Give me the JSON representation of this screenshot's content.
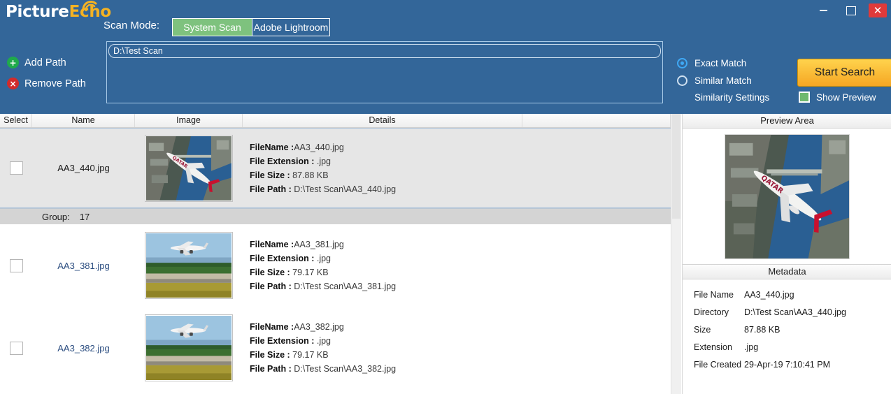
{
  "app": {
    "logo_primary": "Picture",
    "logo_accent": "Echo",
    "accent_color": "#f4b223",
    "header_color": "#336699"
  },
  "window_controls": {
    "minimize": "minimize-icon",
    "maximize": "maximize-icon",
    "close": "✕"
  },
  "scan": {
    "mode_label": "Scan Mode:",
    "tabs": [
      {
        "label": "System Scan",
        "active": true
      },
      {
        "label": "Adobe Lightroom",
        "active": false
      }
    ],
    "paths": [
      "D:\\Test Scan"
    ],
    "add_path": "Add Path",
    "add_icon": "+",
    "remove_path": "Remove Path",
    "remove_icon": "×"
  },
  "options": {
    "exact_match": "Exact Match",
    "similar_match": "Similar Match",
    "similarity_settings": "Similarity Settings",
    "selected": "Exact Match",
    "start_search": "Start Search",
    "show_preview": "Show Preview",
    "show_preview_checked": true,
    "checkbox_color": "#6fb96f"
  },
  "list": {
    "columns": [
      "Select",
      "Name",
      "Image",
      "Details",
      ""
    ],
    "labels": {
      "filename": "FileName :",
      "extension": "File Extension : ",
      "size": "File Size : ",
      "path": "File Path  : "
    },
    "group_label": "Group:",
    "group_count": "17",
    "rows": [
      {
        "name": "AA3_440.jpg",
        "selected": true,
        "checked": false,
        "thumb": "qatar-aerial",
        "filename": "AA3_440.jpg",
        "extension": ".jpg",
        "size": "87.88 KB",
        "path": "D:\\Test Scan\\AA3_440.jpg"
      },
      {
        "name": "AA3_381.jpg",
        "selected": false,
        "checked": false,
        "thumb": "landing-plane",
        "filename": "AA3_381.jpg",
        "extension": ".jpg",
        "size": "79.17 KB",
        "path": "D:\\Test Scan\\AA3_381.jpg"
      },
      {
        "name": "AA3_382.jpg",
        "selected": false,
        "checked": false,
        "thumb": "landing-plane",
        "filename": "AA3_382.jpg",
        "extension": ".jpg",
        "size": "79.17 KB",
        "path": "D:\\Test Scan\\AA3_382.jpg"
      }
    ]
  },
  "preview": {
    "title": "Preview Area",
    "image": "qatar-aerial",
    "metadata_title": "Metadata",
    "metadata": [
      {
        "key": "File Name",
        "value": "AA3_440.jpg"
      },
      {
        "key": "Directory",
        "value": "D:\\Test Scan\\AA3_440.jpg"
      },
      {
        "key": "Size",
        "value": "87.88 KB"
      },
      {
        "key": "Extension",
        "value": ".jpg"
      },
      {
        "key": "File Created",
        "value": "29-Apr-19 7:10:41 PM"
      }
    ]
  }
}
